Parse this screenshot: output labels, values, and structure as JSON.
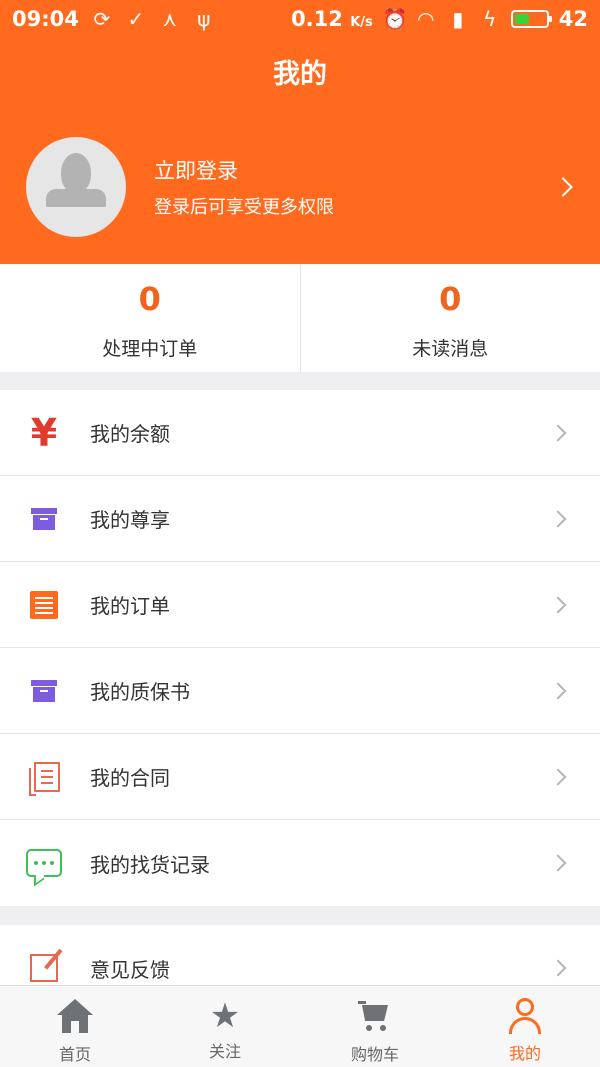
{
  "status_bar": {
    "time": "09:04",
    "left_icons": [
      "sync-icon",
      "check-circle-icon",
      "share-icon",
      "usb-icon"
    ],
    "speed_value": "0.12",
    "speed_unit": "K/s",
    "right_icons": [
      "alarm-icon",
      "wifi-icon",
      "4g-signal-icon",
      "charging-icon"
    ],
    "battery": "42"
  },
  "header": {
    "title": "我的",
    "login_title": "立即登录",
    "login_subtitle": "登录后可享受更多权限"
  },
  "stats": [
    {
      "value": "0",
      "label": "处理中订单"
    },
    {
      "value": "0",
      "label": "未读消息"
    }
  ],
  "menu": {
    "group1": [
      {
        "label": "我的余额",
        "icon": "yen-icon",
        "color": "#e03b2c"
      },
      {
        "label": "我的尊享",
        "icon": "box-icon",
        "color": "#7e5ce0"
      },
      {
        "label": "我的订单",
        "icon": "list-icon",
        "color": "#ff6a1f"
      },
      {
        "label": "我的质保书",
        "icon": "box-icon",
        "color": "#7e5ce0"
      },
      {
        "label": "我的合同",
        "icon": "contract-icon",
        "color": "#e56a4f"
      },
      {
        "label": "我的找货记录",
        "icon": "chat-icon",
        "color": "#3fbf54"
      }
    ],
    "group2": [
      {
        "label": "意见反馈",
        "icon": "edit-icon",
        "color": "#e56a4f"
      }
    ]
  },
  "yen_glyph": "¥",
  "tabbar": [
    {
      "label": "首页",
      "icon": "home-icon",
      "active": false
    },
    {
      "label": "关注",
      "icon": "star-icon",
      "active": false
    },
    {
      "label": "购物车",
      "icon": "cart-icon",
      "active": false
    },
    {
      "label": "我的",
      "icon": "user-icon",
      "active": true
    }
  ],
  "colors": {
    "brand": "#ff6a1f",
    "stat_value": "#f0641e"
  }
}
